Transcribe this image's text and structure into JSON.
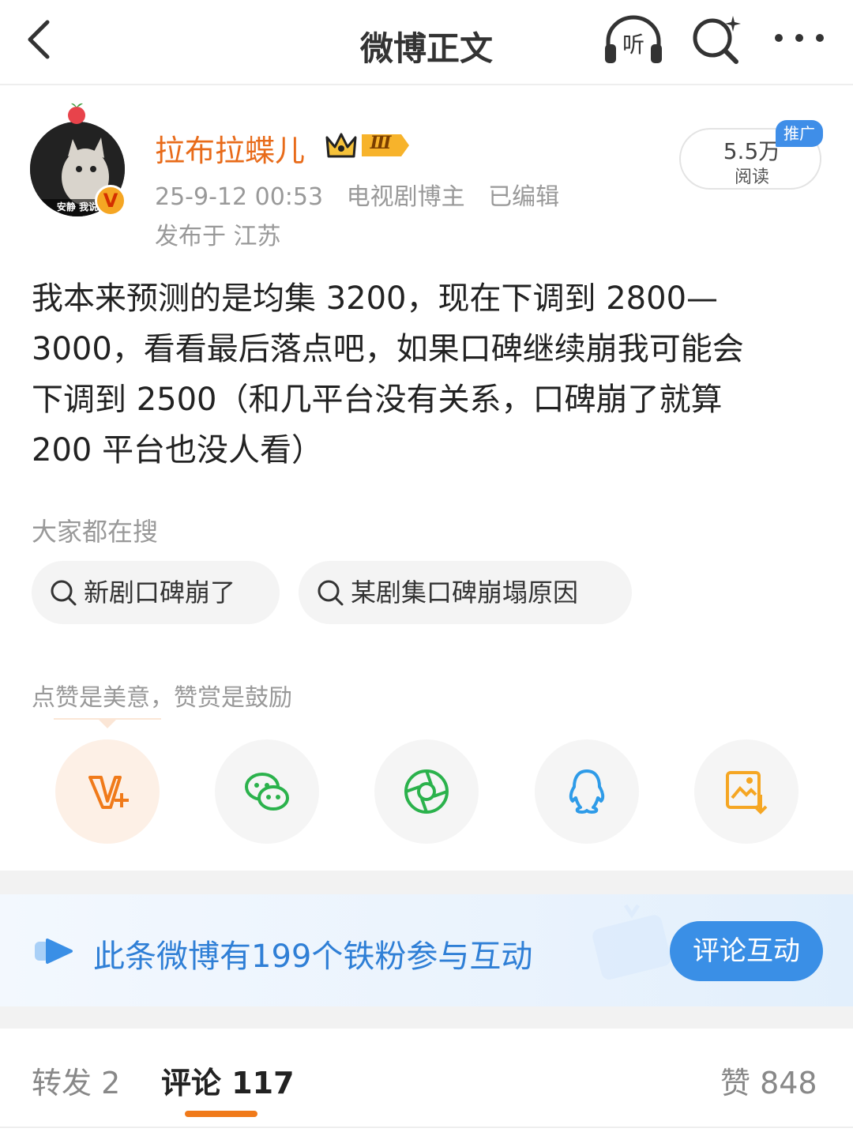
{
  "nav": {
    "title": "微博正文",
    "listen_label": "听"
  },
  "author": {
    "name": "拉布拉蝶儿",
    "level": "Ⅲ",
    "avatar_caption": "安静 我说",
    "verified_mark": "V",
    "timestamp": "25-9-12 00:53",
    "role": "电视剧博主",
    "edited": "已编辑",
    "location": "发布于 江苏"
  },
  "reads": {
    "count": "5.5万",
    "label": "阅读",
    "promo": "推广"
  },
  "post": {
    "lines": [
      "我本来预测的是均集 3200，现在下调到 2800—",
      "3000，看看最后落点吧，如果口碑继续崩我可能会",
      "下调到 2500（和几平台没有关系，口碑崩了就算",
      " 200 平台也没人看）"
    ]
  },
  "hot_search": {
    "title": "大家都在搜",
    "chips": [
      "新剧口碑崩了",
      "某剧集口碑崩塌原因"
    ]
  },
  "reward": {
    "hint": "点赞是美意，赞赏是鼓励"
  },
  "share": {
    "icons": [
      "v-plus-reward-icon",
      "wechat-icon",
      "moments-icon",
      "qq-icon",
      "save-image-icon"
    ]
  },
  "fan_banner": {
    "text": "此条微博有199个铁粉参与互动",
    "button": "评论互动"
  },
  "tabs": {
    "repost": "转发 2",
    "comment": "评论 117",
    "like": "赞 848"
  },
  "colors": {
    "accent_orange": "#f07a1a",
    "username_orange": "#e86b1a",
    "link_blue": "#2f7fd6",
    "button_blue": "#3a8fe6"
  }
}
